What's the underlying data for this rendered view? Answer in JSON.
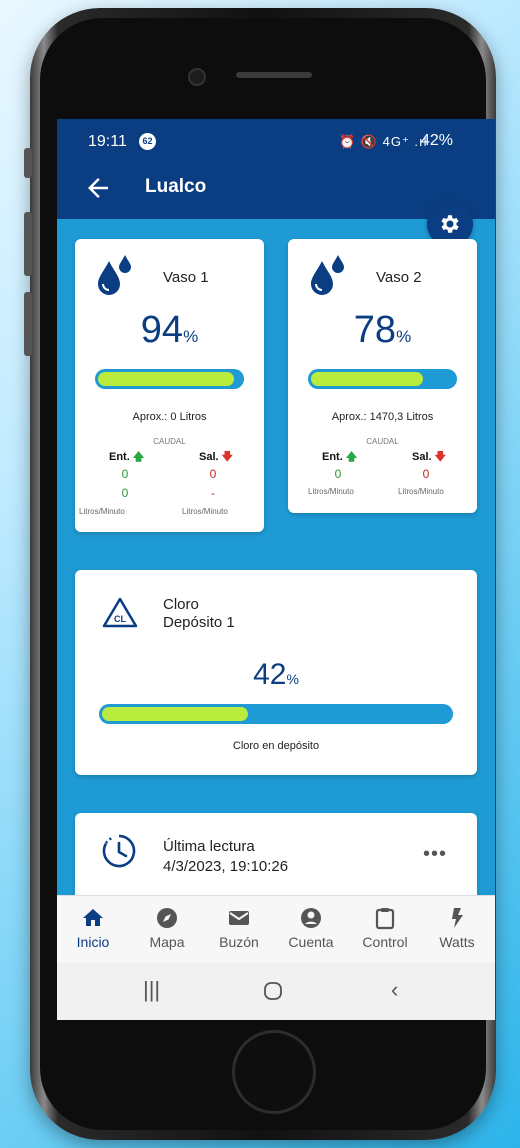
{
  "status_bar": {
    "time": "19:11",
    "notification_count": "62",
    "indicators": "⏰ 🔇 4G⁺ .ıl",
    "battery": "42%"
  },
  "app_bar": {
    "title": "Lualco"
  },
  "vasos": [
    {
      "name": "Vaso 1",
      "percent": "94",
      "percent_unit": "%",
      "fill_fraction": 0.94,
      "approx": "Aprox.: 0 Litros",
      "caudal_label": "CAUDAL",
      "ent_label": "Ent.",
      "sal_label": "Sal.",
      "ent_value_1": "0",
      "sal_value_1": "0",
      "ent_value_2": "0",
      "sal_value_2": "-",
      "ent_unit": "Litros/Minuto",
      "sal_unit": "Litros/Minuto"
    },
    {
      "name": "Vaso 2",
      "percent": "78",
      "percent_unit": "%",
      "fill_fraction": 0.78,
      "approx": "Aprox.: 1470,3 Litros",
      "caudal_label": "CAUDAL",
      "ent_label": "Ent.",
      "sal_label": "Sal.",
      "ent_value_1": "0",
      "sal_value_1": "0",
      "ent_unit": "Litros/Minuto",
      "sal_unit": "Litros/Minuto"
    }
  ],
  "cloro": {
    "icon_text": "CL",
    "title_line1": "Cloro",
    "title_line2": "Depósito 1",
    "percent": "42",
    "percent_unit": "%",
    "fill_fraction": 0.42,
    "caption": "Cloro en depósito"
  },
  "lectura": {
    "label": "Última lectura",
    "value": "4/3/2023, 19:10:26"
  },
  "bottom_nav": [
    {
      "label": "Inicio",
      "icon": "home-icon",
      "active": true
    },
    {
      "label": "Mapa",
      "icon": "compass-icon"
    },
    {
      "label": "Buzón",
      "icon": "mail-icon"
    },
    {
      "label": "Cuenta",
      "icon": "account-icon"
    },
    {
      "label": "Control",
      "icon": "clipboard-icon"
    },
    {
      "label": "Watts",
      "icon": "bolt-icon"
    }
  ],
  "colors": {
    "primary": "#0b3d82",
    "accent": "#1e9ad4",
    "fill": "#b9ec3c",
    "up": "#29a745",
    "down": "#d9332b"
  }
}
